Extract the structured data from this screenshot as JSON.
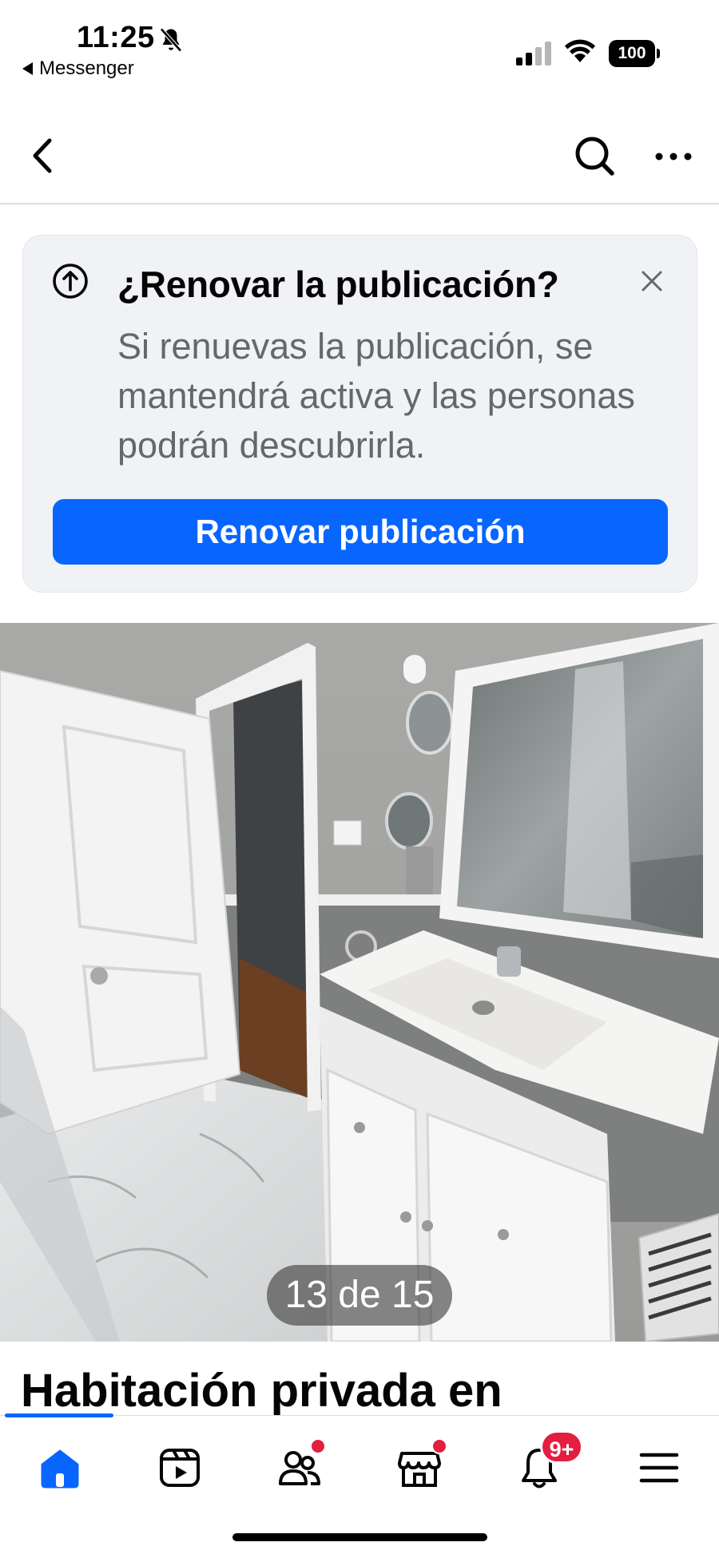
{
  "status_bar": {
    "time": "11:25",
    "back_app": "Messenger",
    "battery": "100",
    "icons": [
      "bell-muted-icon",
      "signal-icon",
      "wifi-icon",
      "battery-icon"
    ]
  },
  "top_nav": {
    "icons": [
      "back-arrow-icon",
      "search-icon",
      "more-icon"
    ]
  },
  "renew_card": {
    "title": "¿Renovar la publicación?",
    "description": "Si renuevas la publicación, se mantendrá activa y las personas podrán descubrirla.",
    "button_label": "Renovar publicación",
    "icons": [
      "arrow-up-circle-icon",
      "close-icon"
    ]
  },
  "photo": {
    "counter": "13 de 15"
  },
  "listing": {
    "title": "Habitación privada en"
  },
  "tab_bar": {
    "tabs": [
      "home-icon",
      "video-icon",
      "friends-icon",
      "marketplace-icon",
      "notifications-icon",
      "menu-icon"
    ],
    "notifications_badge": "9+"
  },
  "colors": {
    "accent": "#0866ff",
    "badge": "#e41e3f",
    "card_bg": "#f0f2f5",
    "secondary_text": "#65676b"
  }
}
